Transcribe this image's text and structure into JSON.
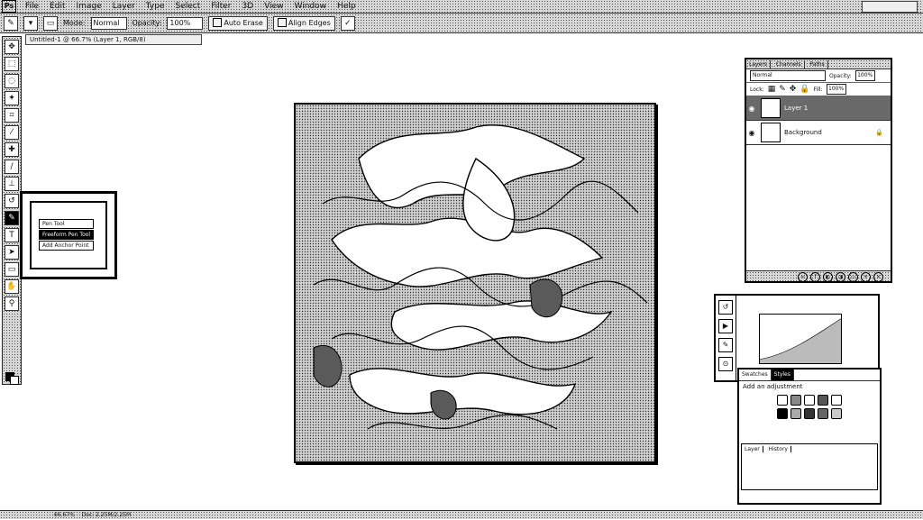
{
  "menubar": {
    "app_logo": "Ps",
    "items": [
      "File",
      "Edit",
      "Image",
      "Layer",
      "Type",
      "Select",
      "Filter",
      "3D",
      "View",
      "Window",
      "Help"
    ]
  },
  "optionsbar": {
    "tool_icon": "pen-tool-icon",
    "mode_label": "Mode:",
    "mode_value": "Normal",
    "opacity_label": "Opacity:",
    "opacity_value": "100%",
    "auto_erase_label": "Auto Erase",
    "align_label": "Align Edges"
  },
  "document": {
    "tab_title": "Untitled-1 @ 66.7% (Layer 1, RGB/8)"
  },
  "flyout": {
    "items": [
      "Pen Tool",
      "Freeform Pen Tool",
      "Add Anchor Point"
    ]
  },
  "layers_panel": {
    "tabs": [
      "Layers",
      "Channels",
      "Paths"
    ],
    "blend_mode": "Normal",
    "opacity_label": "Opacity:",
    "opacity_value": "100%",
    "lock_label": "Lock:",
    "fill_label": "Fill:",
    "fill_value": "100%",
    "layers": [
      {
        "name": "Layer 1",
        "selected": true
      },
      {
        "name": "Background",
        "selected": false
      }
    ]
  },
  "styles_panel": {
    "tabs": [
      "Swatches",
      "Styles"
    ],
    "header": "Add an adjustment",
    "lower_tabs": [
      "Layer",
      "History"
    ]
  },
  "status": {
    "zoom": "66.67%",
    "doc_info": "Doc: 2.25M/2.25M"
  },
  "colors": {
    "foreground": "#000000",
    "background": "#ffffff",
    "selected_layer": "#6a6a6a"
  }
}
